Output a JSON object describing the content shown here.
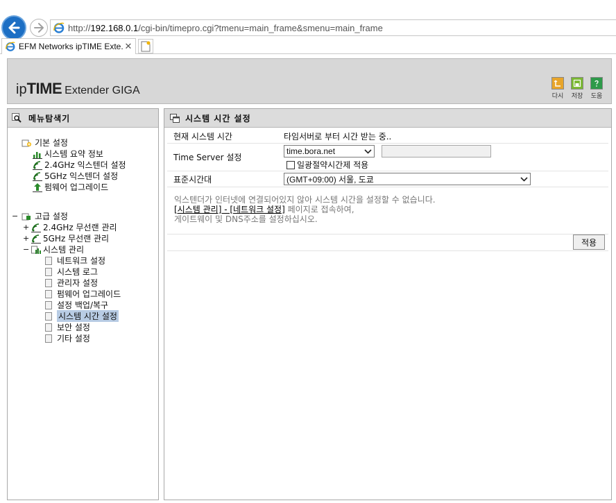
{
  "browser": {
    "url_prefix": "http://",
    "url_host": "192.168.0.1",
    "url_path": "/cgi-bin/timepro.cgi?tmenu=main_frame&smenu=main_frame",
    "tab_title": "EFM Networks ipTIME Exte..."
  },
  "header": {
    "logo_ip": "ip",
    "logo_time": "TIME",
    "logo_ext": "Extender GIGA",
    "tools": [
      "다시",
      "저장",
      "도움"
    ]
  },
  "menu": {
    "title": "메뉴탐색기",
    "basic_group": "기본 설정",
    "basic_items": [
      "시스템 요약 정보",
      "2.4GHz 익스텐더 설정",
      "5GHz 익스텐더 설정",
      "펌웨어 업그레이드"
    ],
    "advanced_group": "고급 설정",
    "advanced_items": [
      "2.4GHz 무선랜 관리",
      "5GHz 무선랜 관리",
      "시스템 관리"
    ],
    "system_items": [
      "네트워크 설정",
      "시스템 로그",
      "관리자 설정",
      "펌웨어 업그레이드",
      "설정 백업/복구",
      "시스템 시간 설정",
      "보안 설정",
      "기타 설정"
    ]
  },
  "content": {
    "title": "시스템 시간 설정",
    "rows": {
      "current_time_label": "현재 시스템 시간",
      "current_time_value": "타임서버로 부터 시간 받는 중..",
      "server_label": "Time Server 설정",
      "server_select": "time.bora.net",
      "server_input": "",
      "dst_label": "일광절약시간제 적용",
      "tz_label": "표준시간대",
      "tz_select": "(GMT+09:00) 서울, 도쿄"
    },
    "notice_line1": "익스텐더가 인터넷에 연결되어있지 않아 시스템 시간을 설정할 수 없습니다.",
    "notice_link": "[시스템 관리] - [네트워크 설정]",
    "notice_line2_rest": " 페이지로 접속하여,",
    "notice_line3": "게이트웨이 및 DNS주소를 설정하십시오.",
    "apply_label": "적용"
  }
}
